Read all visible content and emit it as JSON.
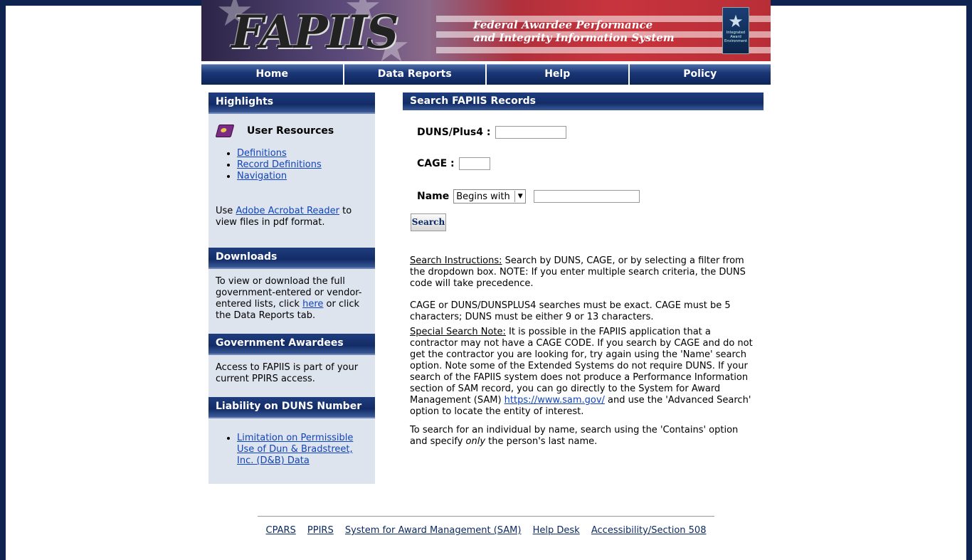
{
  "banner": {
    "logo_text": "FAPIIS",
    "subtitle_line1": "Federal Awardee Performance",
    "subtitle_line2": "and Integrity Information System",
    "badge_text": "Integrated Award Environment"
  },
  "nav": {
    "items": [
      {
        "label": "Home"
      },
      {
        "label": "Data Reports"
      },
      {
        "label": "Help"
      },
      {
        "label": "Policy"
      }
    ]
  },
  "sidebar": {
    "highlights": {
      "heading": "Highlights",
      "user_resources_title": "User Resources",
      "links": [
        "Definitions",
        "Record Definitions",
        "Navigation"
      ],
      "acrobat_prefix": "Use ",
      "acrobat_link": "Adobe Acrobat Reader",
      "acrobat_suffix": " to view files in pdf format."
    },
    "downloads": {
      "heading": "Downloads",
      "text_prefix": "To view or download the full government-entered or vendor-entered lists, click ",
      "here_link": "here",
      "text_suffix": " or click the Data Reports tab."
    },
    "gov_awardees": {
      "heading": "Government Awardees",
      "text": "Access to FAPIIS is part of your current PPIRS access."
    },
    "liability": {
      "heading": "Liability on DUNS Number",
      "link": "Limitation on Permissible Use of Dun & Bradstreet, Inc. (D&B) Data"
    }
  },
  "main": {
    "heading": "Search FAPIIS Records",
    "duns_label": "DUNS/Plus4 :",
    "duns_value": "",
    "cage_label": "CAGE :",
    "cage_value": "",
    "name_label": "Name",
    "name_filter_selected": "Begins with",
    "name_value": "",
    "search_button": "Search",
    "instructions_label": "Search Instructions:",
    "instructions_text": " Search by DUNS, CAGE, or by selecting a filter from the dropdown box. NOTE: If you enter multiple search criteria, the DUNS code will take precedence.",
    "exact_text": "CAGE or DUNS/DUNSPLUS4 searches must be exact. CAGE must be 5 characters; DUNS must be either 9 or 13 characters.",
    "special_label": "Special Search Note:",
    "special_text": "  It is possible in the FAPIIS application that a contractor may not have a CAGE CODE. If you search by CAGE and do not get the contractor you are looking for, try again using the 'Name' search option. Note some of the Extended Systems do not require DUNS. If your search of the FAPIIS system does not produce a Performance Information section of SAM record, you can go directly to the System for Award Management (SAM) ",
    "sam_link": "https://www.sam.gov/",
    "special_suffix": " and use the 'Advanced Search' option to locate the entity of interest.",
    "individual_prefix": "To search for an individual by name, search using the 'Contains' option and specify ",
    "individual_em": "only",
    "individual_suffix": " the person's last name."
  },
  "footer": {
    "links": [
      "CPARS",
      "PPIRS",
      "System for Award Management (SAM)",
      "Help Desk",
      "Accessibility/Section 508"
    ]
  }
}
